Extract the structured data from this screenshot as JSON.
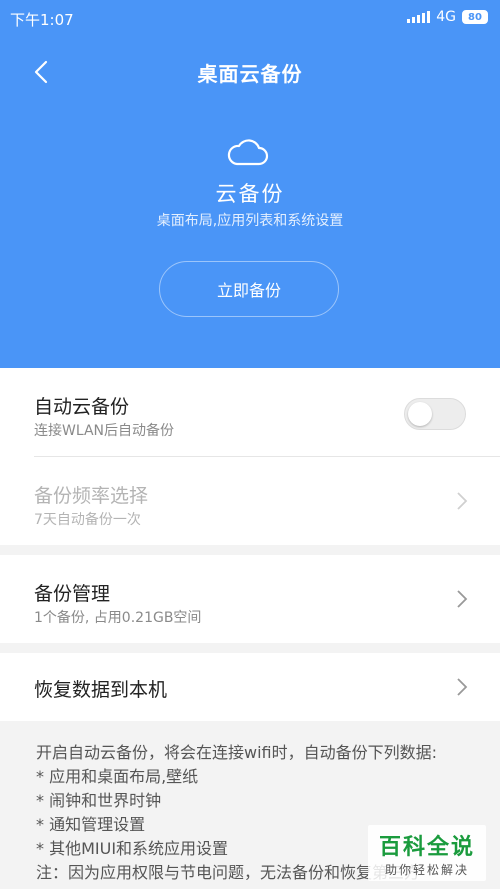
{
  "status_bar": {
    "time": "下午1:07",
    "network": "4G",
    "battery": "80"
  },
  "header": {
    "title": "桌面云备份"
  },
  "hero": {
    "title": "云备份",
    "subtitle": "桌面布局,应用列表和系统设置",
    "button_label": "立即备份"
  },
  "rows": {
    "auto_backup": {
      "title": "自动云备份",
      "subtitle": "连接WLAN后自动备份",
      "enabled": false
    },
    "frequency": {
      "title": "备份频率选择",
      "subtitle": "7天自动备份一次"
    },
    "manage": {
      "title": "备份管理",
      "subtitle": "1个备份, 占用0.21GB空间"
    },
    "restore": {
      "title": "恢复数据到本机"
    }
  },
  "info": {
    "intro": "开启自动云备份，将会在连接wifi时，自动备份下列数据:",
    "bullets": [
      "*  应用和桌面布局,壁纸",
      "*  闹钟和世界时钟",
      "*  通知管理设置",
      "*  其他MIUI和系统应用设置"
    ],
    "note": "注：因为应用权限与节电问题，无法备份和恢复第三方"
  },
  "watermark": {
    "main": "百科全说",
    "sub": "助你轻松解决"
  },
  "colors": {
    "header_bg": "#4a95f7",
    "watermark_green": "#1a9b3d"
  }
}
